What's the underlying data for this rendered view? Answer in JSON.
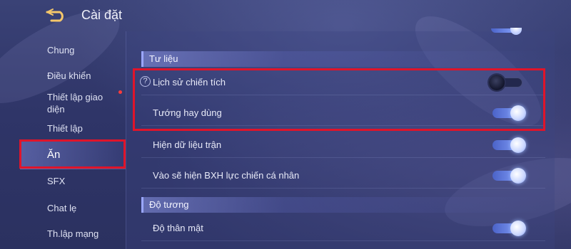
{
  "header": {
    "title": "Cài đặt"
  },
  "sidebar": {
    "items": [
      {
        "label": "Chung"
      },
      {
        "label": "Điều khiển"
      },
      {
        "label": "Thiết lập giao diện"
      },
      {
        "label": "Thiết lập"
      },
      {
        "label": "Ăn"
      },
      {
        "label": "SFX"
      },
      {
        "label": "Chat lẹ"
      },
      {
        "label": "Th.lập mạng"
      }
    ],
    "active_index": 4
  },
  "sections": [
    {
      "title": "Tư liệu",
      "rows": [
        {
          "label": "Lịch sử chiến tích",
          "toggle": "off",
          "help": "?"
        },
        {
          "label": "Tướng hay dùng",
          "toggle": "on"
        },
        {
          "label": "Hiện dữ liệu trận",
          "toggle": "on"
        },
        {
          "label": "Vào sẽ hiện BXH lực chiến cá nhân",
          "toggle": "on"
        }
      ]
    },
    {
      "title": "Độ tương",
      "rows": [
        {
          "label": "Độ thân mật",
          "toggle": "on"
        }
      ]
    }
  ],
  "colors": {
    "highlight": "#e0142a",
    "toggle_on": "#8aa6ff",
    "notification_dot": "#ff3b3b"
  }
}
